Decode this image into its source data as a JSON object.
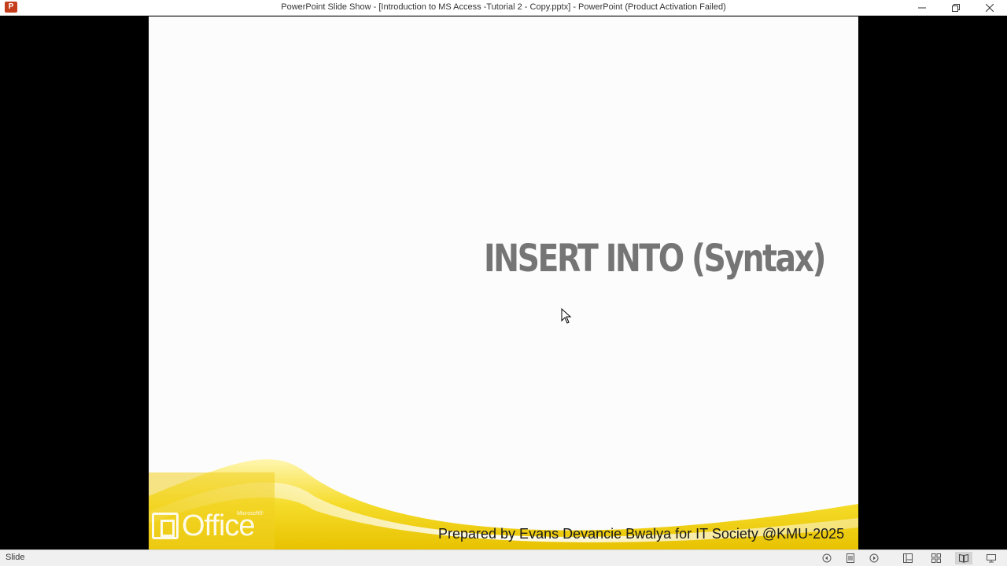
{
  "window": {
    "title": "PowerPoint Slide Show - [Introduction to MS Access -Tutorial 2 - Copy.pptx] - PowerPoint (Product Activation Failed)",
    "app_icon_letter": "P",
    "controls": [
      "minimize-icon",
      "restore-icon",
      "close-icon"
    ]
  },
  "slide": {
    "title": "INSERT INTO (Syntax)",
    "footer_credit": "Prepared by Evans Devancie Bwalya for IT Society @KMU-2025",
    "logo_text": "Office",
    "logo_superscript": "Microsoft®",
    "accent_color": "#f2d21e"
  },
  "statusbar": {
    "label": "Slide",
    "buttons": [
      "previous-icon",
      "notes-icon",
      "next-icon",
      "normal-view-icon",
      "slide-sorter-icon",
      "reading-view-icon",
      "slide-show-icon"
    ]
  }
}
